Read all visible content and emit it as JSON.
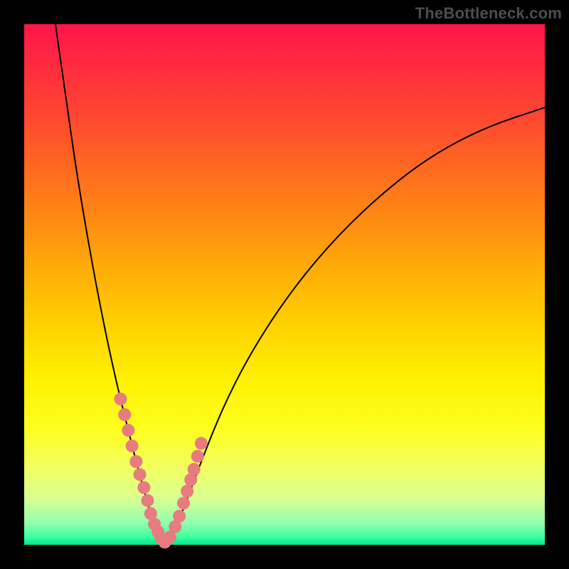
{
  "watermark": "TheBottleneck.com",
  "colors": {
    "background": "#000000",
    "gradient_top": "#ff1649",
    "gradient_bottom": "#00e690",
    "curve": "#000000",
    "points": "#e77b7f"
  },
  "chart_data": {
    "type": "line",
    "title": "",
    "xlabel": "",
    "ylabel": "",
    "xlim": [
      0,
      100
    ],
    "ylim": [
      0,
      100
    ],
    "curve_left": {
      "comment": "Descending branch from upper-left to the valley minimum. y normalized 0-100 (0=bottom, 100=top).",
      "x": [
        6,
        8,
        10,
        12,
        14,
        16,
        18,
        20,
        22,
        24,
        25.5,
        27
      ],
      "y": [
        100,
        86,
        72,
        60,
        49,
        39,
        30,
        22,
        14,
        7,
        2,
        0
      ]
    },
    "curve_right": {
      "comment": "Ascending branch from valley to upper right, shallower than left.",
      "x": [
        27,
        29,
        31,
        34,
        38,
        43,
        50,
        58,
        67,
        77,
        88,
        100
      ],
      "y": [
        0,
        3,
        8,
        16,
        26,
        36,
        47,
        57,
        66,
        74,
        80,
        84
      ]
    },
    "valley_x": 27,
    "series": [
      {
        "name": "highlighted-points",
        "comment": "Scatter points clustered around the valley along both branches, roughly in the lower 30% of the chart.",
        "x": [
          18.5,
          19.3,
          20.0,
          20.7,
          21.5,
          22.2,
          23.0,
          23.7,
          24.3,
          25.0,
          25.7,
          26.3,
          27.0,
          28.0,
          29.0,
          29.8,
          30.6,
          31.3,
          32.0,
          32.6,
          33.3,
          34.0
        ],
        "y": [
          28.0,
          25.0,
          22.0,
          19.0,
          16.0,
          13.5,
          11.0,
          8.5,
          6.0,
          4.0,
          2.5,
          1.2,
          0.5,
          1.5,
          3.5,
          5.5,
          8.0,
          10.3,
          12.5,
          14.5,
          17.0,
          19.5
        ]
      }
    ]
  }
}
